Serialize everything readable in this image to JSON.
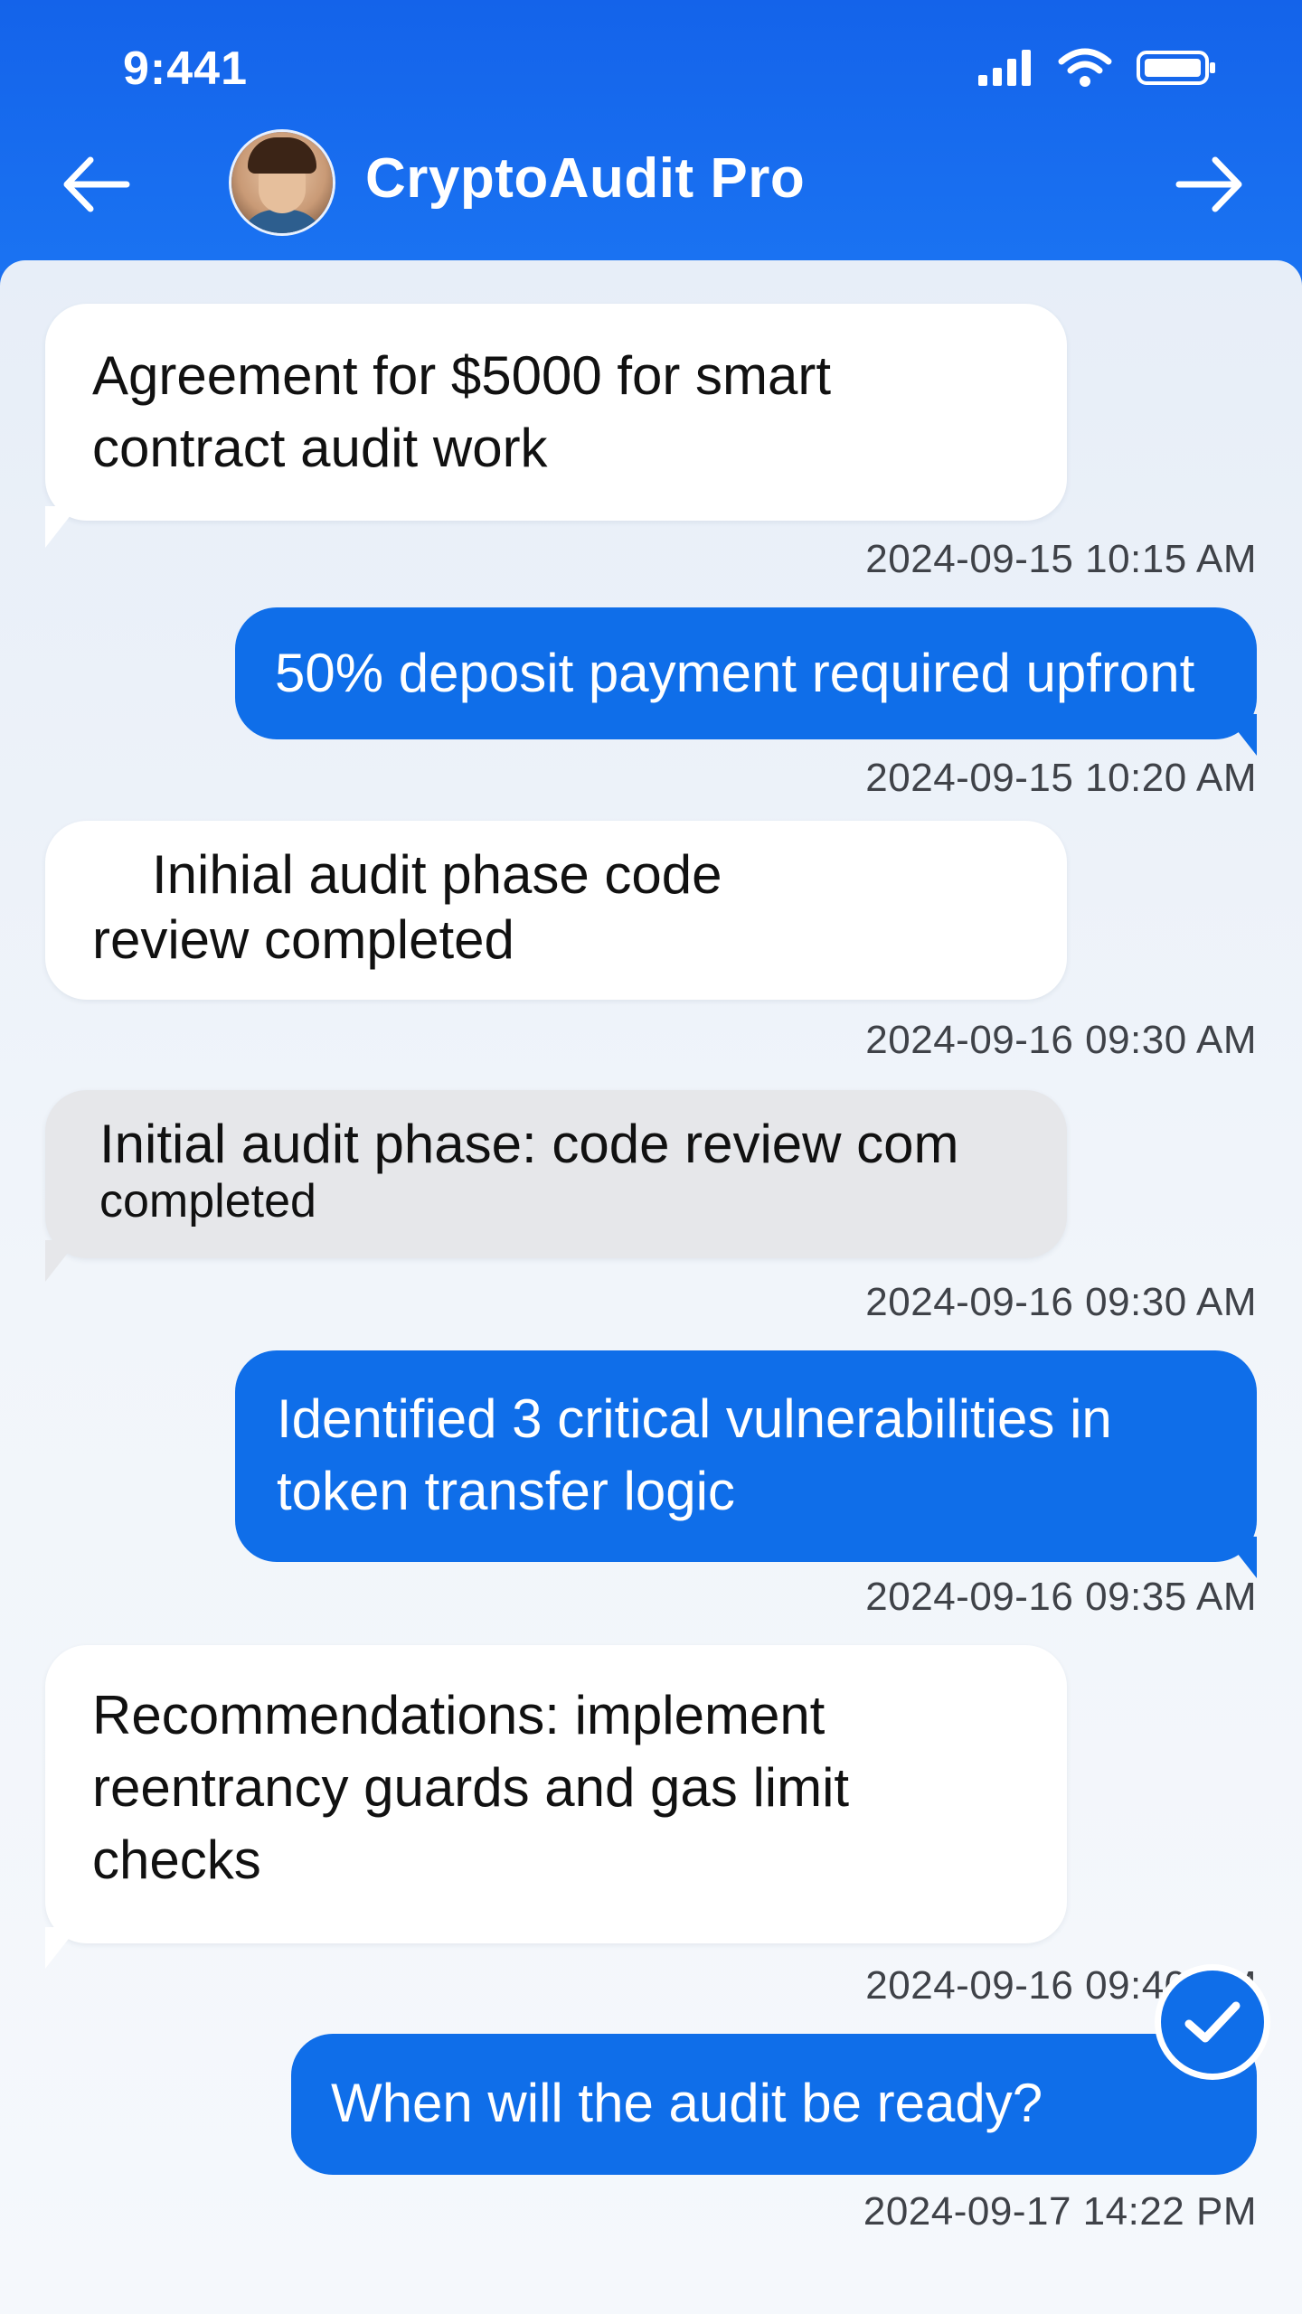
{
  "status_bar": {
    "time": "9:441",
    "icons": [
      "signal-icon",
      "wifi-icon",
      "battery-icon"
    ]
  },
  "header": {
    "title": "CryptoAudit Pro",
    "back_icon": "arrow-left-icon",
    "forward_icon": "arrow-right-icon",
    "avatar": "contact-avatar"
  },
  "colors": {
    "header_blue": "#1463ea",
    "outgoing_bubble": "#0f6ee9",
    "incoming_bubble": "#ffffff",
    "incoming_bubble_grey": "#e6e7ea",
    "chat_background": "#eef3f9"
  },
  "messages": [
    {
      "direction": "incoming",
      "lines": [
        "Agreement for $5000 for smart",
        "contract audit work"
      ],
      "timestamp": "2024-09-15 10:15 AM"
    },
    {
      "direction": "outgoing",
      "lines": [
        "50% deposit payment required upfront"
      ],
      "timestamp": "2024-09-15 10:20 AM"
    },
    {
      "direction": "incoming",
      "lines": [
        "Inihial audit phase   code",
        "review completed"
      ],
      "timestamp": "2024-09-16 09:30 AM"
    },
    {
      "direction": "incoming",
      "style": "grey",
      "lines": [
        "Initial audit phase: code review com",
        "completed"
      ],
      "timestamp": "2024-09-16 09:30 AM"
    },
    {
      "direction": "outgoing",
      "lines": [
        "Identified 3 critical vulnerabilities in",
        "token transfer logic"
      ],
      "timestamp": "2024-09-16 09:35 AM"
    },
    {
      "direction": "incoming",
      "lines": [
        "Recommendations: implement",
        "reentrancy guards and gas limit",
        "checks"
      ],
      "timestamp": "2024-09-16 09:40 AM"
    },
    {
      "direction": "outgoing",
      "lines": [
        "When will the audit be ready?"
      ],
      "timestamp": "2024-09-17 14:22 PM",
      "read_icon": "checkmark-icon"
    }
  ]
}
